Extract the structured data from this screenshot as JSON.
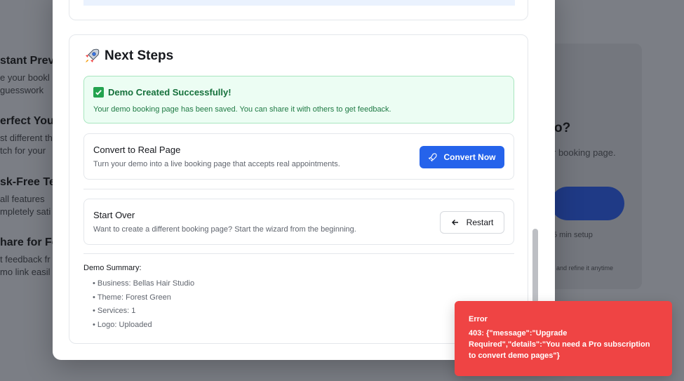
{
  "background": {
    "features": [
      {
        "title": "stant Prev",
        "line1": "e your bookl",
        "line2": "guesswork"
      },
      {
        "title": "erfect Your",
        "line1": "st different th",
        "line2": "tch for your"
      },
      {
        "title": "sk-Free Te",
        "line1": "all features",
        "line2": "mpletely sati"
      },
      {
        "title": "hare for Fe",
        "line1": "t feedback fr",
        "line2": "mo link easil"
      }
    ],
    "card": {
      "question": "o?",
      "subtitle": "r booking page.",
      "setup": "5 min setup",
      "refine": "and refine it anytime"
    }
  },
  "next_steps": {
    "title": "Next Steps",
    "success": {
      "title": "Demo Created Successfully!",
      "message": "Your demo booking page has been saved. You can share it with others to get feedback."
    },
    "convert": {
      "title": "Convert to Real Page",
      "description": "Turn your demo into a live booking page that accepts real appointments.",
      "button_label": "Convert Now"
    },
    "restart": {
      "title": "Start Over",
      "description": "Want to create a different booking page? Start the wizard from the beginning.",
      "button_label": "Restart"
    },
    "summary": {
      "title": "Demo Summary:",
      "items": [
        "Business: Bellas Hair Studio",
        "Theme: Forest Green",
        "Services: 1",
        "Logo: Uploaded"
      ]
    }
  },
  "toast": {
    "title": "Error",
    "message": "403: {\"message\":\"Upgrade Required\",\"details\":\"You need a Pro subscription to convert demo pages\"}"
  },
  "colors": {
    "accent": "#2563eb",
    "success": "#15703b",
    "error": "#ef4444"
  }
}
